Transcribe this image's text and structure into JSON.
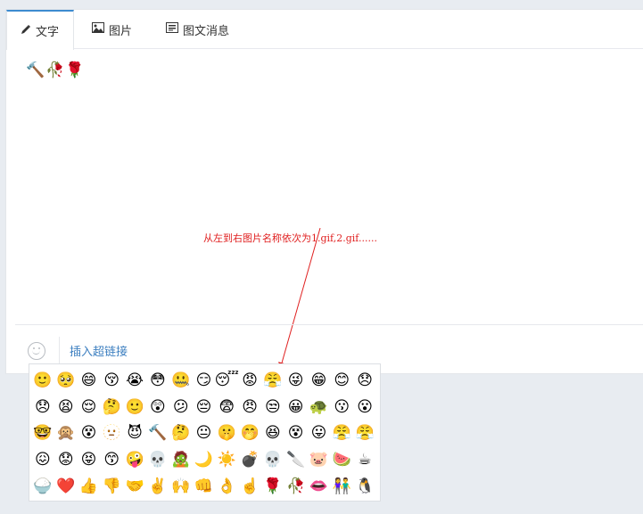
{
  "tabs": [
    {
      "label": "文字",
      "icon": "pencil-icon",
      "active": true
    },
    {
      "label": "图片",
      "icon": "image-icon",
      "active": false
    },
    {
      "label": "图文消息",
      "icon": "news-icon",
      "active": false
    }
  ],
  "editor": {
    "typed_emojis": [
      "🔨",
      "🥀",
      "🌹"
    ],
    "annotation": "从左到右图片名称依次为1.gif,2.gif......"
  },
  "toolbar": {
    "emoji_button_icon": "smile-icon",
    "insert_link_label": "插入超链接"
  },
  "emoji_panel": {
    "emojis": [
      "🙂",
      "🥺",
      "😄",
      "😚",
      "😭",
      "😳",
      "🤐",
      "😏",
      "😴",
      "😡",
      "😤",
      "😜",
      "😁",
      "😊",
      "😞",
      "😞",
      "😫",
      "😌",
      "🤔",
      "🙂",
      "😲",
      "😕",
      "😔",
      "😨",
      "😠",
      "😒",
      "😀",
      "🐢",
      "😗",
      "😮",
      "🤓",
      "🙊",
      "😵",
      "🫥",
      "😈",
      "🔨",
      "🤔",
      "😐",
      "🤫",
      "🤭",
      "😆",
      "😵",
      "😛",
      "😤",
      "😤",
      "😖",
      "😟",
      "😝",
      "😙",
      "🤪",
      "💀",
      "🧟",
      "🌙",
      "☀️",
      "💣",
      "💀",
      "🔪",
      "🐷",
      "🍉",
      "☕",
      "🍚",
      "❤️",
      "👍",
      "👎",
      "🤝",
      "✌️",
      "🙌",
      "👊",
      "👌",
      "☝️",
      "🌹",
      "🥀",
      "👄",
      "👫",
      "🐧"
    ]
  }
}
